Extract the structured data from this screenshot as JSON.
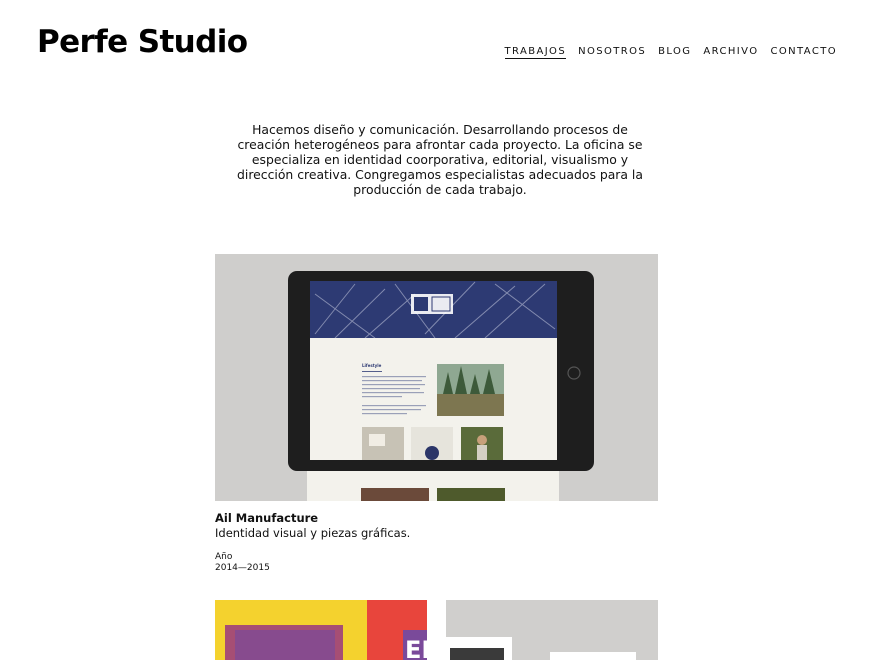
{
  "header": {
    "logo": "Perfe Studio",
    "nav": [
      {
        "label": "TRABAJOS",
        "active": true
      },
      {
        "label": "NOSOTROS"
      },
      {
        "label": "BLOG"
      },
      {
        "label": "ARCHIVO"
      },
      {
        "label": "CONTACTO"
      }
    ]
  },
  "intro": {
    "text": "Hacemos diseño y comunicación. Desarrollando procesos de creación heterogéneos para afrontar cada proyecto. La oficina se especializa en identidad coorporativa, editorial, visualismo y dirección creativa. Congregamos especialistas adecuados para la producción de cada trabajo."
  },
  "projects": [
    {
      "title": "Ail Manufacture",
      "description": "Identidad visual y piezas gráficas.",
      "year_label": "Año",
      "year": "2014—2015",
      "screen_heading": "Lifestyle"
    }
  ],
  "next_row": {
    "card_a_text": "EL"
  },
  "colors": {
    "accent_yellow": "#f4d22e",
    "accent_red": "#e8453c",
    "accent_purple": "#7a4a9a",
    "tablet_frame": "#1e1e1e",
    "thumb_bg": "#cfcecc"
  }
}
